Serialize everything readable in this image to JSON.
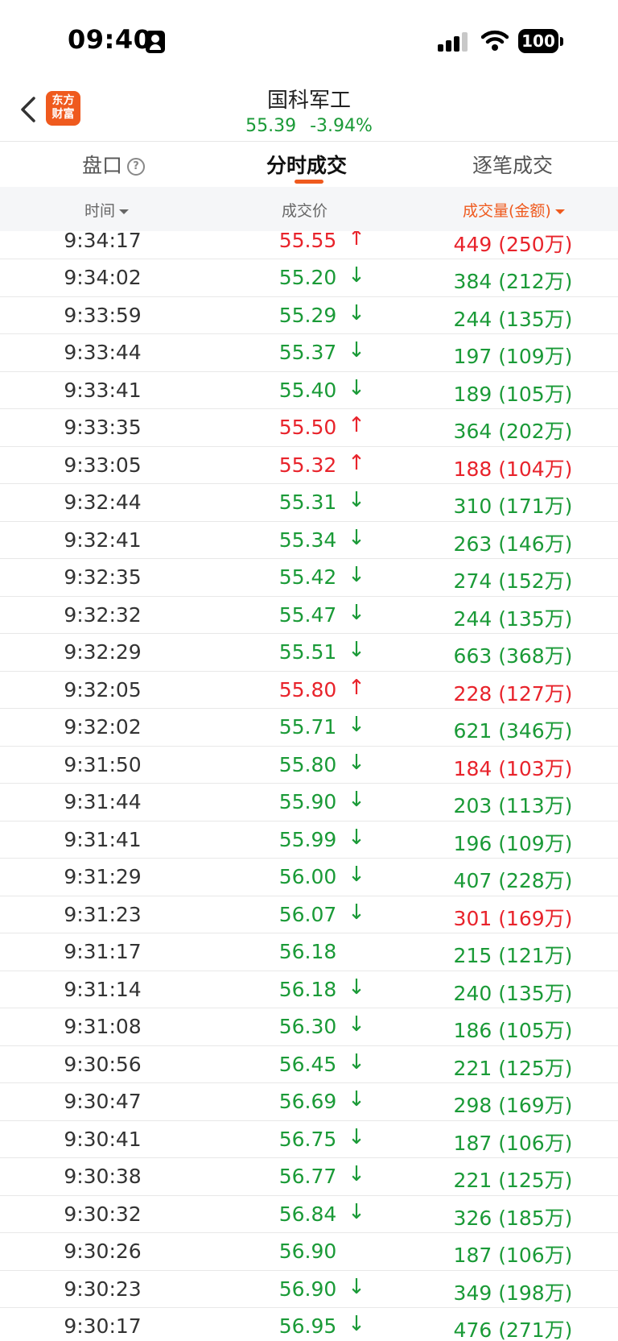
{
  "status_bar": {
    "time": "09:40",
    "battery": "100"
  },
  "header": {
    "logo_line1": "东方",
    "logo_line2": "财富",
    "title": "国科军工",
    "price": "55.39",
    "change": "-3.94%"
  },
  "tabs": [
    {
      "label": "盘口"
    },
    {
      "label": "分时成交"
    },
    {
      "label": "逐笔成交"
    }
  ],
  "columns": {
    "time": "时间",
    "price": "成交价",
    "volume": "成交量(金额)"
  },
  "colors": {
    "green": "#1a9a37",
    "red": "#e8232b",
    "accent": "#ef5a1e"
  },
  "trades": [
    {
      "time": "9:34:17",
      "price": "55.55",
      "dir": "↑",
      "dir_color": "red",
      "volume": "449 (250万)",
      "vol_color": "red"
    },
    {
      "time": "9:34:02",
      "price": "55.20",
      "dir": "↓",
      "dir_color": "green",
      "volume": "384 (212万)",
      "vol_color": "green"
    },
    {
      "time": "9:33:59",
      "price": "55.29",
      "dir": "↓",
      "dir_color": "green",
      "volume": "244 (135万)",
      "vol_color": "green"
    },
    {
      "time": "9:33:44",
      "price": "55.37",
      "dir": "↓",
      "dir_color": "green",
      "volume": "197 (109万)",
      "vol_color": "green"
    },
    {
      "time": "9:33:41",
      "price": "55.40",
      "dir": "↓",
      "dir_color": "green",
      "volume": "189 (105万)",
      "vol_color": "green"
    },
    {
      "time": "9:33:35",
      "price": "55.50",
      "dir": "↑",
      "dir_color": "red",
      "volume": "364 (202万)",
      "vol_color": "green"
    },
    {
      "time": "9:33:05",
      "price": "55.32",
      "dir": "↑",
      "dir_color": "red",
      "volume": "188 (104万)",
      "vol_color": "red"
    },
    {
      "time": "9:32:44",
      "price": "55.31",
      "dir": "↓",
      "dir_color": "green",
      "volume": "310 (171万)",
      "vol_color": "green"
    },
    {
      "time": "9:32:41",
      "price": "55.34",
      "dir": "↓",
      "dir_color": "green",
      "volume": "263 (146万)",
      "vol_color": "green"
    },
    {
      "time": "9:32:35",
      "price": "55.42",
      "dir": "↓",
      "dir_color": "green",
      "volume": "274 (152万)",
      "vol_color": "green"
    },
    {
      "time": "9:32:32",
      "price": "55.47",
      "dir": "↓",
      "dir_color": "green",
      "volume": "244 (135万)",
      "vol_color": "green"
    },
    {
      "time": "9:32:29",
      "price": "55.51",
      "dir": "↓",
      "dir_color": "green",
      "volume": "663 (368万)",
      "vol_color": "green"
    },
    {
      "time": "9:32:05",
      "price": "55.80",
      "dir": "↑",
      "dir_color": "red",
      "volume": "228 (127万)",
      "vol_color": "red"
    },
    {
      "time": "9:32:02",
      "price": "55.71",
      "dir": "↓",
      "dir_color": "green",
      "volume": "621 (346万)",
      "vol_color": "green"
    },
    {
      "time": "9:31:50",
      "price": "55.80",
      "dir": "↓",
      "dir_color": "green",
      "volume": "184 (103万)",
      "vol_color": "red"
    },
    {
      "time": "9:31:44",
      "price": "55.90",
      "dir": "↓",
      "dir_color": "green",
      "volume": "203 (113万)",
      "vol_color": "green"
    },
    {
      "time": "9:31:41",
      "price": "55.99",
      "dir": "↓",
      "dir_color": "green",
      "volume": "196 (109万)",
      "vol_color": "green"
    },
    {
      "time": "9:31:29",
      "price": "56.00",
      "dir": "↓",
      "dir_color": "green",
      "volume": "407 (228万)",
      "vol_color": "green"
    },
    {
      "time": "9:31:23",
      "price": "56.07",
      "dir": "↓",
      "dir_color": "green",
      "volume": "301 (169万)",
      "vol_color": "red"
    },
    {
      "time": "9:31:17",
      "price": "56.18",
      "dir": "",
      "dir_color": "green",
      "volume": "215 (121万)",
      "vol_color": "green"
    },
    {
      "time": "9:31:14",
      "price": "56.18",
      "dir": "↓",
      "dir_color": "green",
      "volume": "240 (135万)",
      "vol_color": "green"
    },
    {
      "time": "9:31:08",
      "price": "56.30",
      "dir": "↓",
      "dir_color": "green",
      "volume": "186 (105万)",
      "vol_color": "green"
    },
    {
      "time": "9:30:56",
      "price": "56.45",
      "dir": "↓",
      "dir_color": "green",
      "volume": "221 (125万)",
      "vol_color": "green"
    },
    {
      "time": "9:30:47",
      "price": "56.69",
      "dir": "↓",
      "dir_color": "green",
      "volume": "298 (169万)",
      "vol_color": "green"
    },
    {
      "time": "9:30:41",
      "price": "56.75",
      "dir": "↓",
      "dir_color": "green",
      "volume": "187 (106万)",
      "vol_color": "green"
    },
    {
      "time": "9:30:38",
      "price": "56.77",
      "dir": "↓",
      "dir_color": "green",
      "volume": "221 (125万)",
      "vol_color": "green"
    },
    {
      "time": "9:30:32",
      "price": "56.84",
      "dir": "↓",
      "dir_color": "green",
      "volume": "326 (185万)",
      "vol_color": "green"
    },
    {
      "time": "9:30:26",
      "price": "56.90",
      "dir": "",
      "dir_color": "green",
      "volume": "187 (106万)",
      "vol_color": "green"
    },
    {
      "time": "9:30:23",
      "price": "56.90",
      "dir": "↓",
      "dir_color": "green",
      "volume": "349 (198万)",
      "vol_color": "green"
    },
    {
      "time": "9:30:17",
      "price": "56.95",
      "dir": "↓",
      "dir_color": "green",
      "volume": "476 (271万)",
      "vol_color": "green"
    }
  ]
}
